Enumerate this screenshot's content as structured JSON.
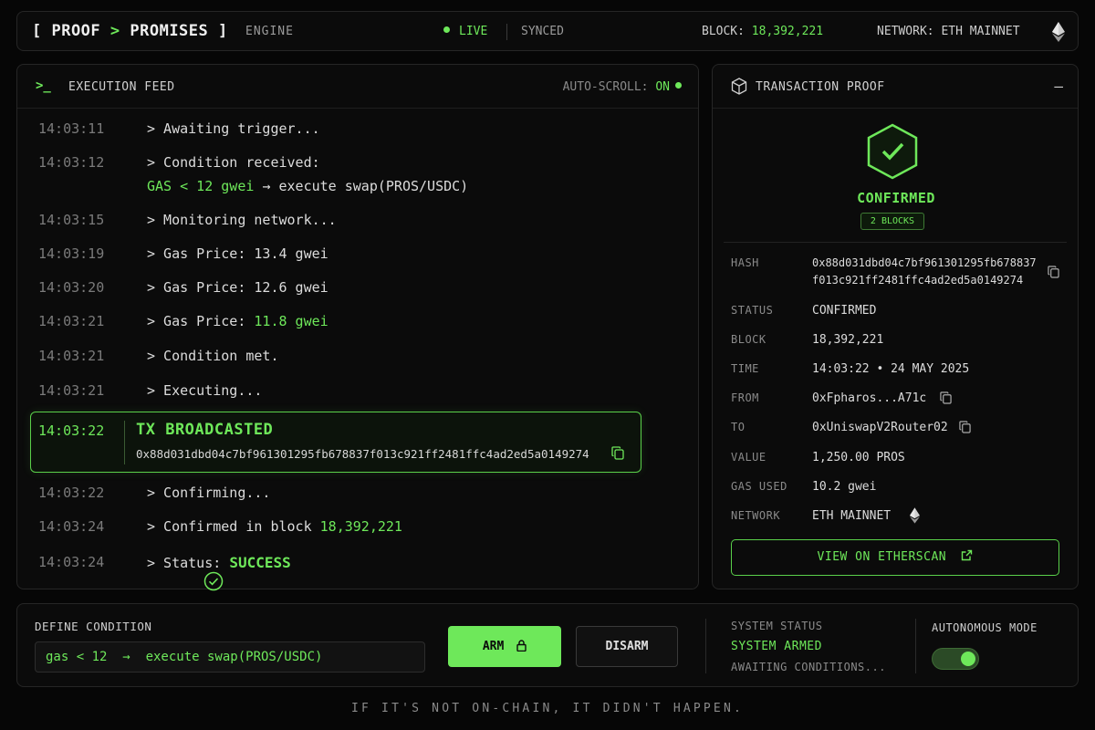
{
  "header": {
    "brand_open": "[ PROOF ",
    "brand_gt": ">",
    "brand_close": " PROMISES ]",
    "engine": "ENGINE",
    "live": "LIVE",
    "synced": "SYNCED",
    "block_label": "BLOCK:",
    "block_value": "18,392,221",
    "network": "NETWORK: ETH MAINNET",
    "network_icon": "ethereum-icon"
  },
  "feed": {
    "title": "EXECUTION FEED",
    "prompt": ">_",
    "autoscroll_label": "AUTO-SCROLL:",
    "autoscroll_value": "ON",
    "lines": [
      {
        "time": "14:03:11",
        "text": "> Awaiting trigger..."
      },
      {
        "time": "14:03:12",
        "text": "> Condition received:",
        "cond": "GAS < 12 gwei",
        "arrow": "→",
        "action": "execute swap(PROS/USDC)"
      },
      {
        "time": "14:03:15",
        "text": "> Monitoring network..."
      },
      {
        "time": "14:03:19",
        "text": "> Gas Price: 13.4 gwei"
      },
      {
        "time": "14:03:20",
        "text": "> Gas Price: 12.6 gwei"
      },
      {
        "time": "14:03:21",
        "prefix": "> Gas Price: ",
        "value": "11.8 gwei"
      },
      {
        "time": "14:03:21",
        "text": "> Condition met."
      },
      {
        "time": "14:03:21",
        "text": "> Executing..."
      },
      {
        "time": "14:03:22",
        "text": "> Confirming..."
      },
      {
        "time": "14:03:24",
        "prefix": "> Confirmed in block ",
        "value": "18,392,221"
      },
      {
        "time": "14:03:24",
        "prefix": "> Status: ",
        "value": "SUCCESS"
      }
    ],
    "tx": {
      "time": "14:03:22",
      "title": "TX BROADCASTED",
      "hash": "0x88d031dbd04c7bf961301295fb678837f013c921ff2481ffc4ad2ed5a0149274"
    }
  },
  "proof": {
    "title": "TRANSACTION PROOF",
    "collapse": "—",
    "status_title": "CONFIRMED",
    "blocks_badge": "2 BLOCKS",
    "rows": {
      "hash_label": "HASH",
      "hash_line1": "0x88d031dbd04c7bf961301295fb678837",
      "hash_line2": "f013c921ff2481ffc4ad2ed5a0149274",
      "status_label": "STATUS",
      "status_value": "CONFIRMED",
      "block_label": "BLOCK",
      "block_value": "18,392,221",
      "time_label": "TIME",
      "time_value": "14:03:22 • 24 MAY 2025",
      "from_label": "FROM",
      "from_value": "0xFpharos...A71c",
      "to_label": "TO",
      "to_value": "0xUniswapV2Router02",
      "value_label": "VALUE",
      "value_value": "1,250.00 PROS",
      "gas_label": "GAS USED",
      "gas_value": "10.2 gwei",
      "network_label": "NETWORK",
      "network_value": "ETH MAINNET"
    },
    "etherscan_button": "VIEW ON ETHERSCAN"
  },
  "controls": {
    "define_label": "DEFINE CONDITION",
    "condition_value": "gas < 12  →  execute swap(PROS/USDC)",
    "arm_label": "ARM",
    "disarm_label": "DISARM",
    "system_status_label": "SYSTEM STATUS",
    "system_status_value": "SYSTEM ARMED",
    "system_status_sub": "AWAITING CONDITIONS...",
    "autonomous_label": "AUTONOMOUS MODE",
    "autonomous_on": true
  },
  "footer": {
    "tagline": "IF IT'S NOT ON-CHAIN, IT DIDN'T HAPPEN."
  },
  "colors": {
    "accent": "#6ee85a",
    "background": "#060606",
    "panel": "#0b0b0b"
  }
}
